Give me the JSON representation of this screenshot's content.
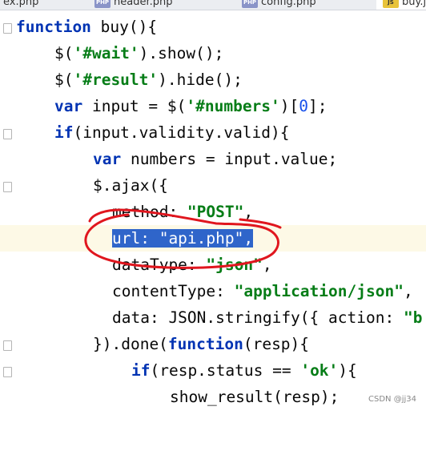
{
  "tabs": [
    {
      "label": "ex.php",
      "icon": "php-file-icon"
    },
    {
      "label": "header.php",
      "icon": "php-file-icon"
    },
    {
      "label": "config.php",
      "icon": "php-file-icon"
    },
    {
      "label": "buy.js",
      "icon": "js-file-icon"
    }
  ],
  "code": {
    "l1": {
      "kw": "function",
      "rest": " buy(){"
    },
    "l2": {
      "a": "$(",
      "s": "'#wait'",
      "b": ").show();"
    },
    "l3": {
      "a": "$(",
      "s": "'#result'",
      "b": ").hide();"
    },
    "l4": {
      "kw": "var",
      "a": " input = $(",
      "s": "'#numbers'",
      "b": ")[",
      "n": "0",
      "c": "];"
    },
    "l5": {
      "kw": "if",
      "rest": "(input.validity.valid){"
    },
    "l6": {
      "kw": "var",
      "rest": " numbers = input.value;"
    },
    "l7": {
      "rest": "$.ajax({"
    },
    "l8": {
      "p": "method: ",
      "s": "\"POST\"",
      "b": ","
    },
    "l9": {
      "selected": "url: \"api.php\","
    },
    "l10": {
      "p": "dataType: ",
      "s": "\"json\"",
      "b": ","
    },
    "l11": {
      "p": "contentType: ",
      "s": "\"application/json\"",
      "b": ","
    },
    "l12": {
      "p": "data: JSON.stringify({ action: ",
      "s": "\"b"
    },
    "l13": {
      "a": "}).done(",
      "kw": "function",
      "b": "(resp){"
    },
    "l14": {
      "kw": "if",
      "a": "(resp.status == ",
      "s": "'ok'",
      "b": "){"
    },
    "l15": {
      "rest": "show_result(resp);"
    }
  },
  "colors": {
    "keyword": "#0033b3",
    "string": "#067d17",
    "number": "#1750eb",
    "selection": "#2f65ca",
    "annotation": "#e0161e"
  },
  "watermark": "CSDN @jj34"
}
